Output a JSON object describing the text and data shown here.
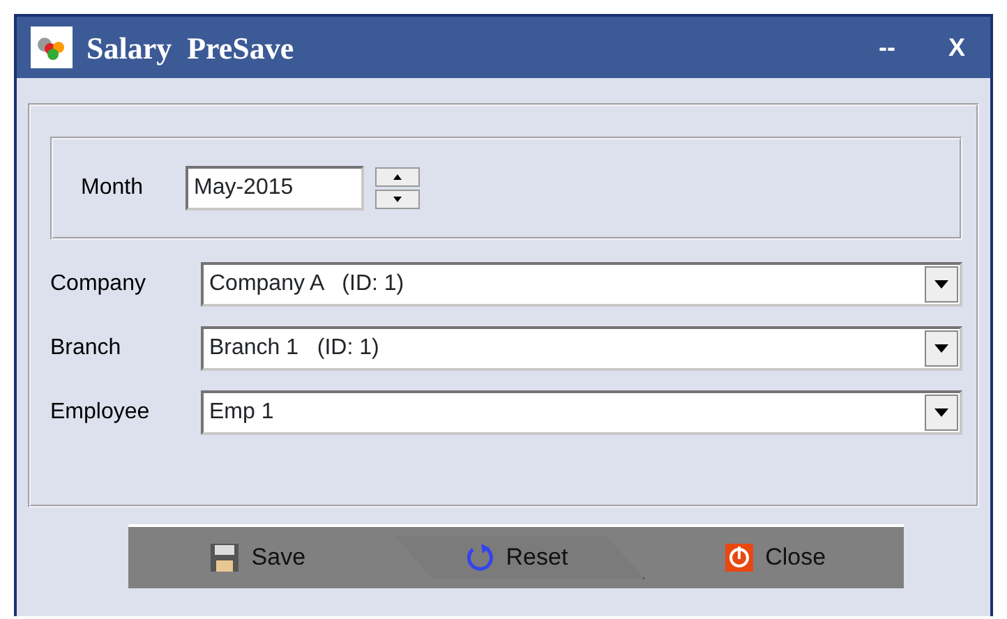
{
  "window": {
    "title": "Salary  PreSave",
    "controls": [
      "--",
      "X"
    ]
  },
  "month": {
    "label": "Month",
    "value": "May-2015"
  },
  "fields": [
    {
      "label": "Company",
      "value": "Company A   (ID: 1)"
    },
    {
      "label": "Branch",
      "value": "Branch 1   (ID: 1)"
    },
    {
      "label": "Employee",
      "value": "Emp 1"
    }
  ],
  "buttons": [
    {
      "label": "Save",
      "kind": "save",
      "selected": false
    },
    {
      "label": "Reset",
      "kind": "reset",
      "selected": true
    },
    {
      "label": "Close",
      "kind": "close",
      "selected": false
    }
  ]
}
